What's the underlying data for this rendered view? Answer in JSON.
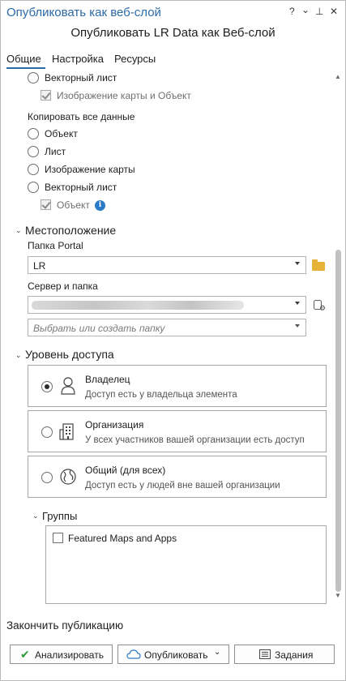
{
  "window": {
    "title": "Опубликовать как веб-слой",
    "controls": [
      "?",
      "⌄",
      "⊥",
      "✕"
    ]
  },
  "subtitle": "Опубликовать LR Data как Веб-слой",
  "tabs": [
    "Общие",
    "Настройка",
    "Ресурсы"
  ],
  "options": {
    "vector_tile_top": "Векторный лист",
    "map_image_object": "Изображение карты и Объект",
    "copy_all_label": "Копировать все данные",
    "copy_options": [
      "Объект",
      "Лист",
      "Изображение карты",
      "Векторный лист"
    ],
    "object_sub": "Объект"
  },
  "location": {
    "title": "Местоположение",
    "portal_folder_label": "Папка Portal",
    "portal_folder_value": "LR",
    "server_folder_label": "Сервер и папка",
    "folder_placeholder": "Выбрать или создать папку"
  },
  "access": {
    "title": "Уровень доступа",
    "cards": [
      {
        "title": "Владелец",
        "desc": "Доступ есть у владельца элемента",
        "selected": true
      },
      {
        "title": "Организация",
        "desc": "У всех участников вашей организации есть доступ",
        "selected": false
      },
      {
        "title": "Общий (для всех)",
        "desc": "Доступ есть у людей вне вашей организации",
        "selected": false
      }
    ],
    "groups_title": "Группы",
    "groups": [
      {
        "label": "Featured Maps and Apps",
        "checked": false
      }
    ]
  },
  "footer": {
    "finish_title": "Закончить публикацию",
    "analyze_label": "Анализировать",
    "publish_label": "Опубликовать",
    "jobs_label": "Задания"
  },
  "colors": {
    "accent": "#2b6aa8",
    "info": "#2b7ac8",
    "check_green": "#2e9b3b"
  }
}
